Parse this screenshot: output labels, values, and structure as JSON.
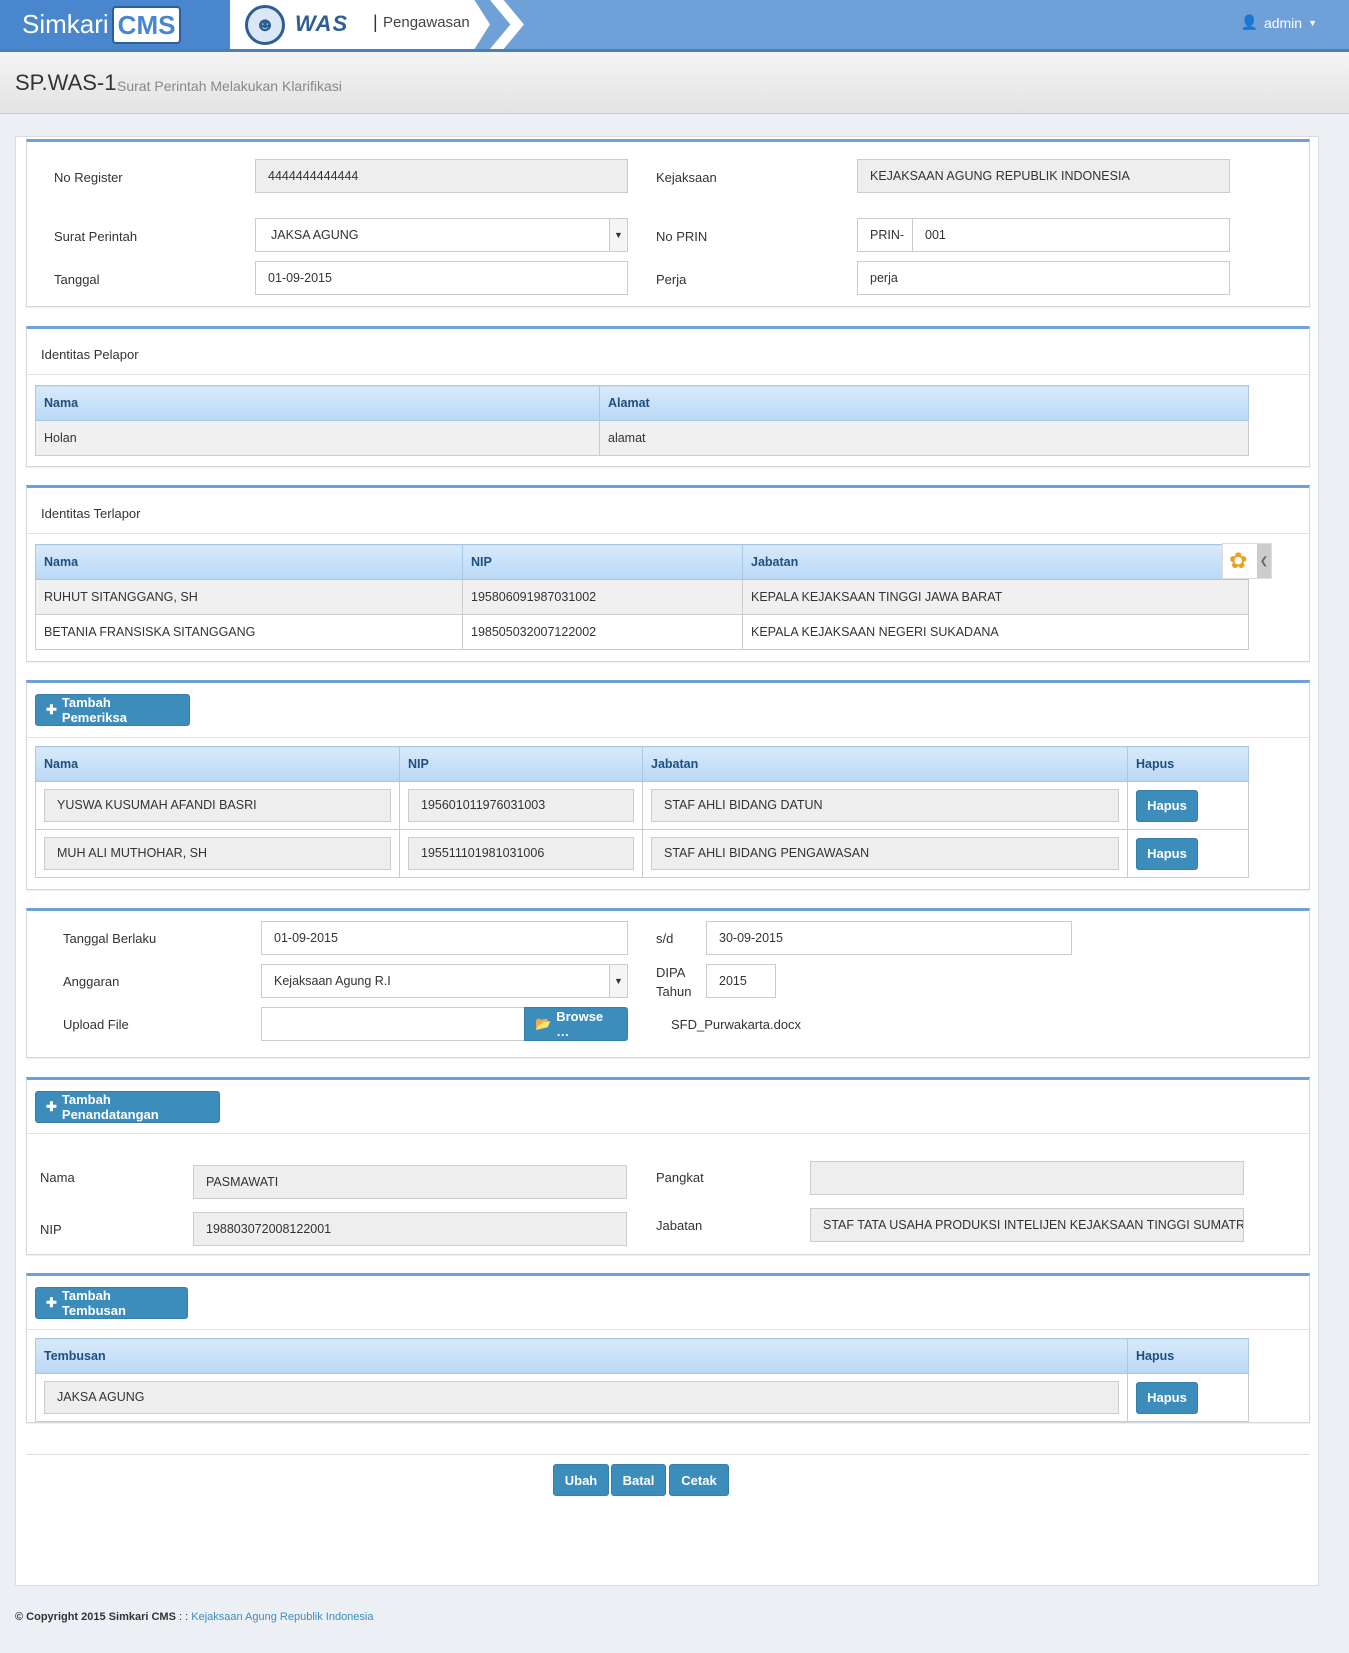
{
  "app": {
    "logo_word": "Simkari",
    "logo_cms": "CMS",
    "module_name": "WAS",
    "module_sep": "|",
    "module_sub": "Pengawasan",
    "user": "admin"
  },
  "page": {
    "title": "SP.WAS-1",
    "subtitle": "Surat Perintah Melakukan Klarifikasi"
  },
  "form1": {
    "no_register_label": "No Register",
    "no_register": "4444444444444",
    "kejaksaan_label": "Kejaksaan",
    "kejaksaan": "KEJAKSAAN AGUNG REPUBLIK INDONESIA",
    "surat_perintah_label": "Surat Perintah",
    "surat_perintah": "JAKSA AGUNG",
    "no_prin_label": "No PRIN",
    "no_prin_prefix": "PRIN-",
    "no_prin": "001",
    "tanggal_label": "Tanggal",
    "tanggal": "01-09-2015",
    "perja_label": "Perja",
    "perja": "perja"
  },
  "pelapor": {
    "title": "Identitas Pelapor",
    "col_nama": "Nama",
    "col_alamat": "Alamat",
    "nama": "Holan",
    "alamat": "alamat"
  },
  "terlapor": {
    "title": "Identitas Terlapor",
    "col_nama": "Nama",
    "col_nip": "NIP",
    "col_jabatan": "Jabatan",
    "rows": [
      {
        "nama": "RUHUT SITANGGANG, SH",
        "nip": "195806091987031002",
        "jabatan": "KEPALA KEJAKSAAN TINGGI JAWA BARAT"
      },
      {
        "nama": "BETANIA FRANSISKA SITANGGANG",
        "nip": "198505032007122002",
        "jabatan": "KEPALA KEJAKSAAN NEGERI SUKADANA"
      }
    ]
  },
  "pemeriksa": {
    "add_label": "Tambah Pemeriksa",
    "col_nama": "Nama",
    "col_nip": "NIP",
    "col_jabatan": "Jabatan",
    "col_hapus": "Hapus",
    "hapus_label": "Hapus",
    "rows": [
      {
        "nama": "YUSWA KUSUMAH AFANDI BASRI",
        "nip": "195601011976031003",
        "jabatan": "STAF AHLI BIDANG DATUN"
      },
      {
        "nama": "MUH ALI MUTHOHAR, SH",
        "nip": "195511101981031006",
        "jabatan": "STAF AHLI BIDANG PENGAWASAN"
      }
    ]
  },
  "form2": {
    "tgl_berlaku_label": "Tanggal Berlaku",
    "tgl_berlaku": "01-09-2015",
    "sd_label": "s/d",
    "sd": "30-09-2015",
    "anggaran_label": "Anggaran",
    "anggaran": "Kejaksaan Agung R.I",
    "dipa_label_1": "DIPA",
    "dipa_label_2": "Tahun",
    "dipa": "2015",
    "upload_label": "Upload File",
    "browse_label": "Browse …",
    "file_name": "SFD_Purwakarta.docx"
  },
  "penandatangan": {
    "add_label": "Tambah Penandatangan",
    "nama_label": "Nama",
    "nama": "PASMAWATI",
    "nip_label": "NIP",
    "nip": "198803072008122001",
    "pangkat_label": "Pangkat",
    "pangkat": "",
    "jabatan_label": "Jabatan",
    "jabatan": "STAF TATA USAHA PRODUKSI  INTELIJEN KEJAKSAAN TINGGI SUMATRA SELATAN"
  },
  "tembusan": {
    "add_label": "Tambah Tembusan",
    "col_tembusan": "Tembusan",
    "col_hapus": "Hapus",
    "hapus_label": "Hapus",
    "rows": [
      {
        "nama": "JAKSA AGUNG"
      }
    ]
  },
  "actions": {
    "ubah": "Ubah",
    "batal": "Batal",
    "cetak": "Cetak"
  },
  "footer": {
    "copyright": "© Copyright 2015 Simkari CMS",
    "sep": " : : ",
    "link": "Kejaksaan Agung Republik Indonesia"
  },
  "colors": {
    "primary": "#3c8dbc",
    "header": "#6fa0d8",
    "logo_bg": "#4a86cd"
  }
}
